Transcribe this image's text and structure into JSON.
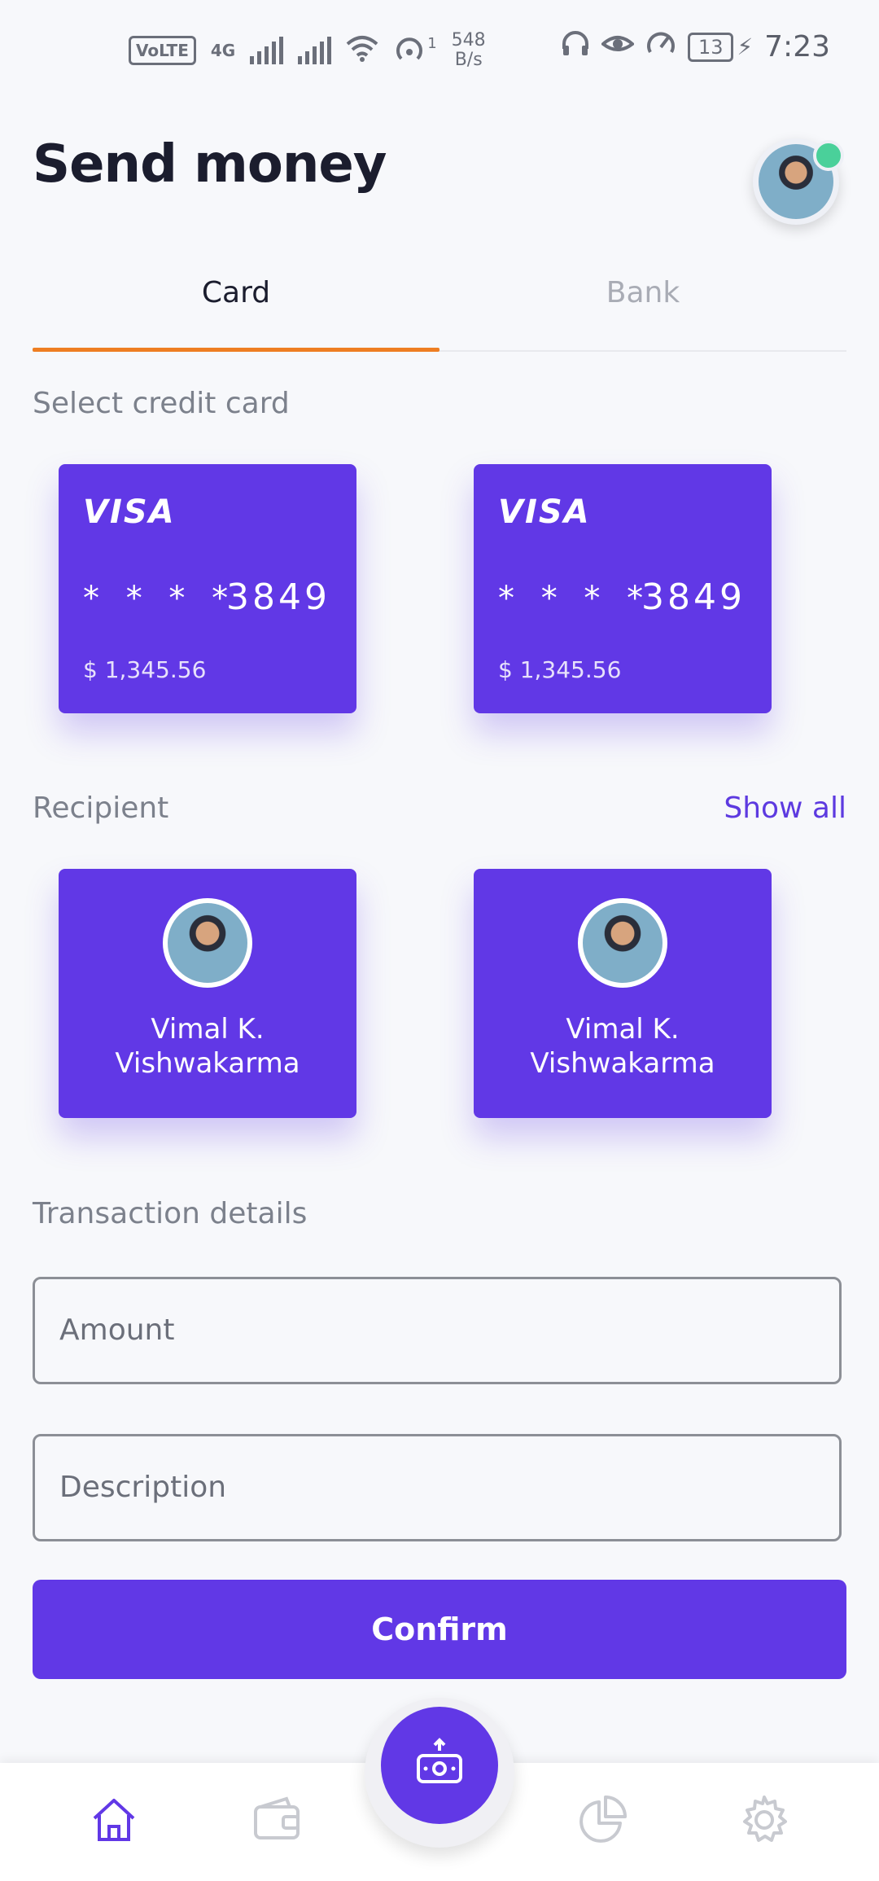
{
  "status_bar": {
    "volte": "VoLTE",
    "network": "4G",
    "hotspot_count": "1",
    "speed_value": "548",
    "speed_unit": "B/s",
    "battery": "13",
    "time": "7:23"
  },
  "header": {
    "title": "Send money"
  },
  "tabs": [
    {
      "label": "Card",
      "active": true
    },
    {
      "label": "Bank",
      "active": false
    }
  ],
  "select_card": {
    "label": "Select credit card",
    "cards": [
      {
        "brand": "VISA",
        "mask": "* * * *",
        "last4": "3849",
        "balance": "$ 1,345.56"
      },
      {
        "brand": "VISA",
        "mask": "* * * *",
        "last4": "3849",
        "balance": "$ 1,345.56"
      }
    ]
  },
  "recipient": {
    "label": "Recipient",
    "show_all": "Show all",
    "people": [
      {
        "name_line1": "Vimal K.",
        "name_line2": "Vishwakarma"
      },
      {
        "name_line1": "Vimal K.",
        "name_line2": "Vishwakarma"
      }
    ]
  },
  "transaction": {
    "label": "Transaction details",
    "amount_placeholder": "Amount",
    "description_placeholder": "Description",
    "confirm_label": "Confirm"
  },
  "nav": {
    "items": [
      "home-icon",
      "wallet-icon",
      "send-money-icon",
      "pie-chart-icon",
      "settings-icon"
    ],
    "active": "home-icon"
  },
  "colors": {
    "accent": "#6138e6",
    "tab_underline": "#ee7e22",
    "online": "#4ad09a"
  }
}
